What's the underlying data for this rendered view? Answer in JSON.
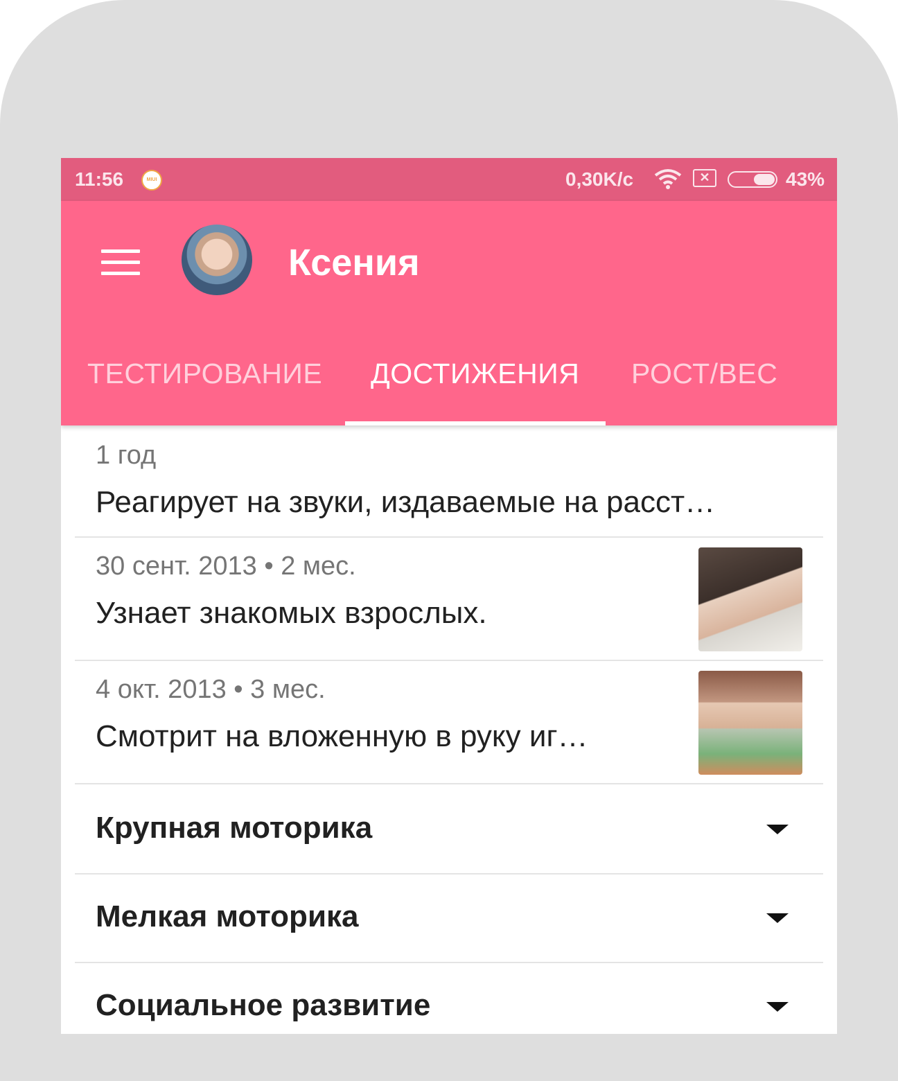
{
  "status_bar": {
    "time": "11:56",
    "miui_badge": "MIUI",
    "network_speed": "0,30K/c",
    "sim_icon": "✕",
    "battery_percent": "43%",
    "battery_level": 0.43
  },
  "app_bar": {
    "title": "Ксения",
    "accent_color": "#ff668b",
    "status_color": "#e25c7e"
  },
  "tabs": [
    {
      "label": "ТЕСТИРОВАНИЕ",
      "active": false
    },
    {
      "label": "ДОСТИЖЕНИЯ",
      "active": true
    },
    {
      "label": "РОСТ/ВЕС",
      "active": false
    }
  ],
  "achievements": [
    {
      "meta": "1 год",
      "text": "Реагирует на звуки, издаваемые на расст…",
      "has_photo": false
    },
    {
      "meta": "30 сент. 2013 • 2 мес.",
      "text": "Узнает знакомых взрослых.",
      "has_photo": true
    },
    {
      "meta": "4 окт. 2013 • 3 мес.",
      "text": "Смотрит на вложенную в руку иг…",
      "has_photo": true
    }
  ],
  "sections": [
    {
      "label": "Крупная моторика"
    },
    {
      "label": "Мелкая моторика"
    },
    {
      "label": "Социальное развитие"
    }
  ]
}
